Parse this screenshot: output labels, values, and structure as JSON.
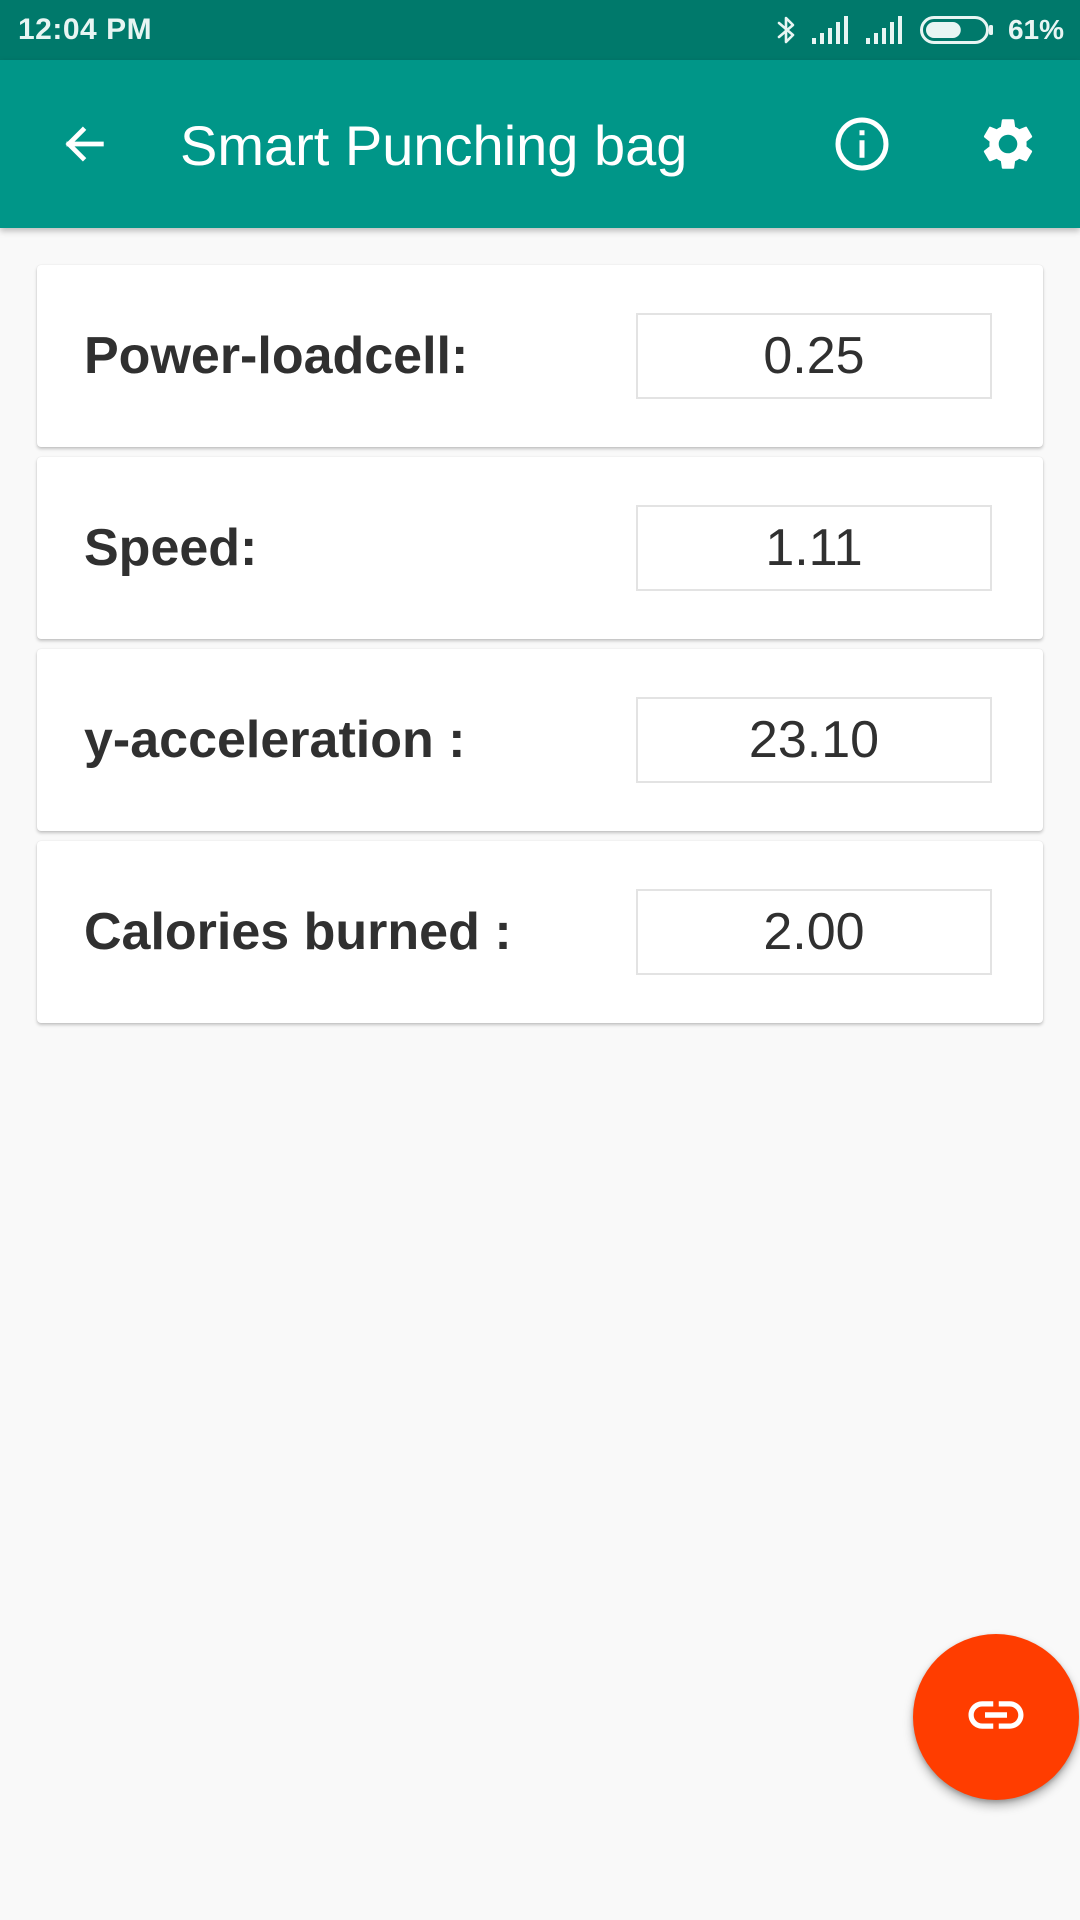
{
  "status_bar": {
    "time": "12:04 PM",
    "battery_percent": "61%",
    "battery_level": 0.61,
    "icons": [
      "bluetooth-icon",
      "signal-icon",
      "signal-icon",
      "battery-icon"
    ]
  },
  "app_bar": {
    "title": "Smart Punching bag",
    "color": "#009688",
    "icons": [
      "back-arrow-icon",
      "info-icon",
      "settings-gear-icon"
    ]
  },
  "metrics": [
    {
      "label": "Power-loadcell:",
      "value": "0.25"
    },
    {
      "label": "Speed:",
      "value": "1.11"
    },
    {
      "label": "y-acceleration :",
      "value": "23.10"
    },
    {
      "label": "Calories burned :",
      "value": "2.00"
    }
  ],
  "fab": {
    "icon": "link-icon",
    "color": "#ff3d00"
  }
}
